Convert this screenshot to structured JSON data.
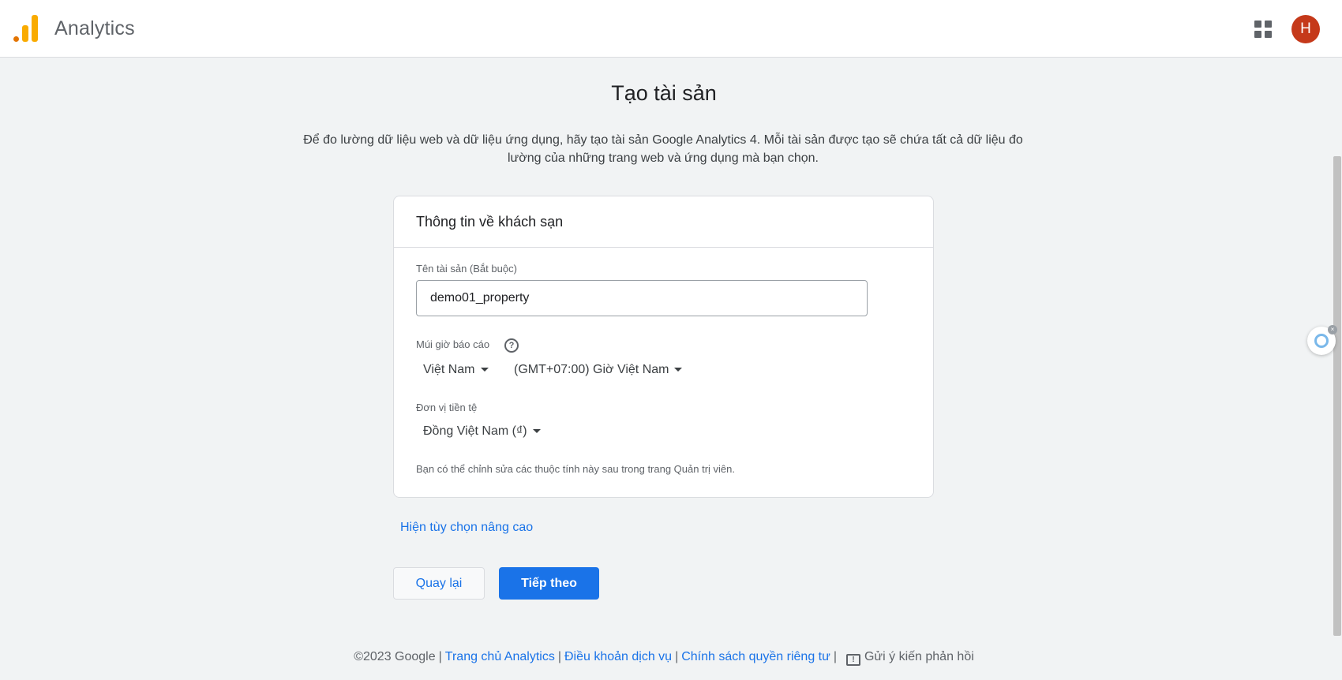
{
  "header": {
    "app_title": "Analytics",
    "avatar_letter": "H",
    "apps_icon": "apps-grid-icon",
    "logo_icon": "analytics-logo-icon"
  },
  "page": {
    "title": "Tạo tài sản",
    "intro": "Để đo lường dữ liệu web và dữ liệu ứng dụng, hãy tạo tài sản Google Analytics 4. Mỗi tài sản được tạo sẽ chứa tất cả dữ liệu đo lường của những trang web và ứng dụng mà bạn chọn."
  },
  "card": {
    "header": "Thông tin về khách sạn",
    "property_name_label": "Tên tài sản (Bắt buộc)",
    "property_name_value": "demo01_property",
    "timezone_label": "Múi giờ báo cáo",
    "country_value": "Việt Nam",
    "timezone_value": "(GMT+07:00) Giờ Việt Nam",
    "currency_label": "Đơn vị tiền tệ",
    "currency_value": "Đồng Việt Nam (₫)",
    "note": "Bạn có thể chỉnh sửa các thuộc tính này sau trong trang Quản trị viên."
  },
  "actions": {
    "advanced_link": "Hiện tùy chọn nâng cao",
    "back_label": "Quay lại",
    "next_label": "Tiếp theo"
  },
  "footer": {
    "copyright": "©2023 Google",
    "links": [
      "Trang chủ Analytics",
      "Điều khoản dịch vụ",
      "Chính sách quyền riêng tư"
    ],
    "feedback": "Gửi ý kiến phản hồi"
  },
  "colors": {
    "accent": "#1a73e8",
    "avatar": "#c5391a",
    "logo_orange": "#f9ab00",
    "background": "#f1f3f4"
  }
}
